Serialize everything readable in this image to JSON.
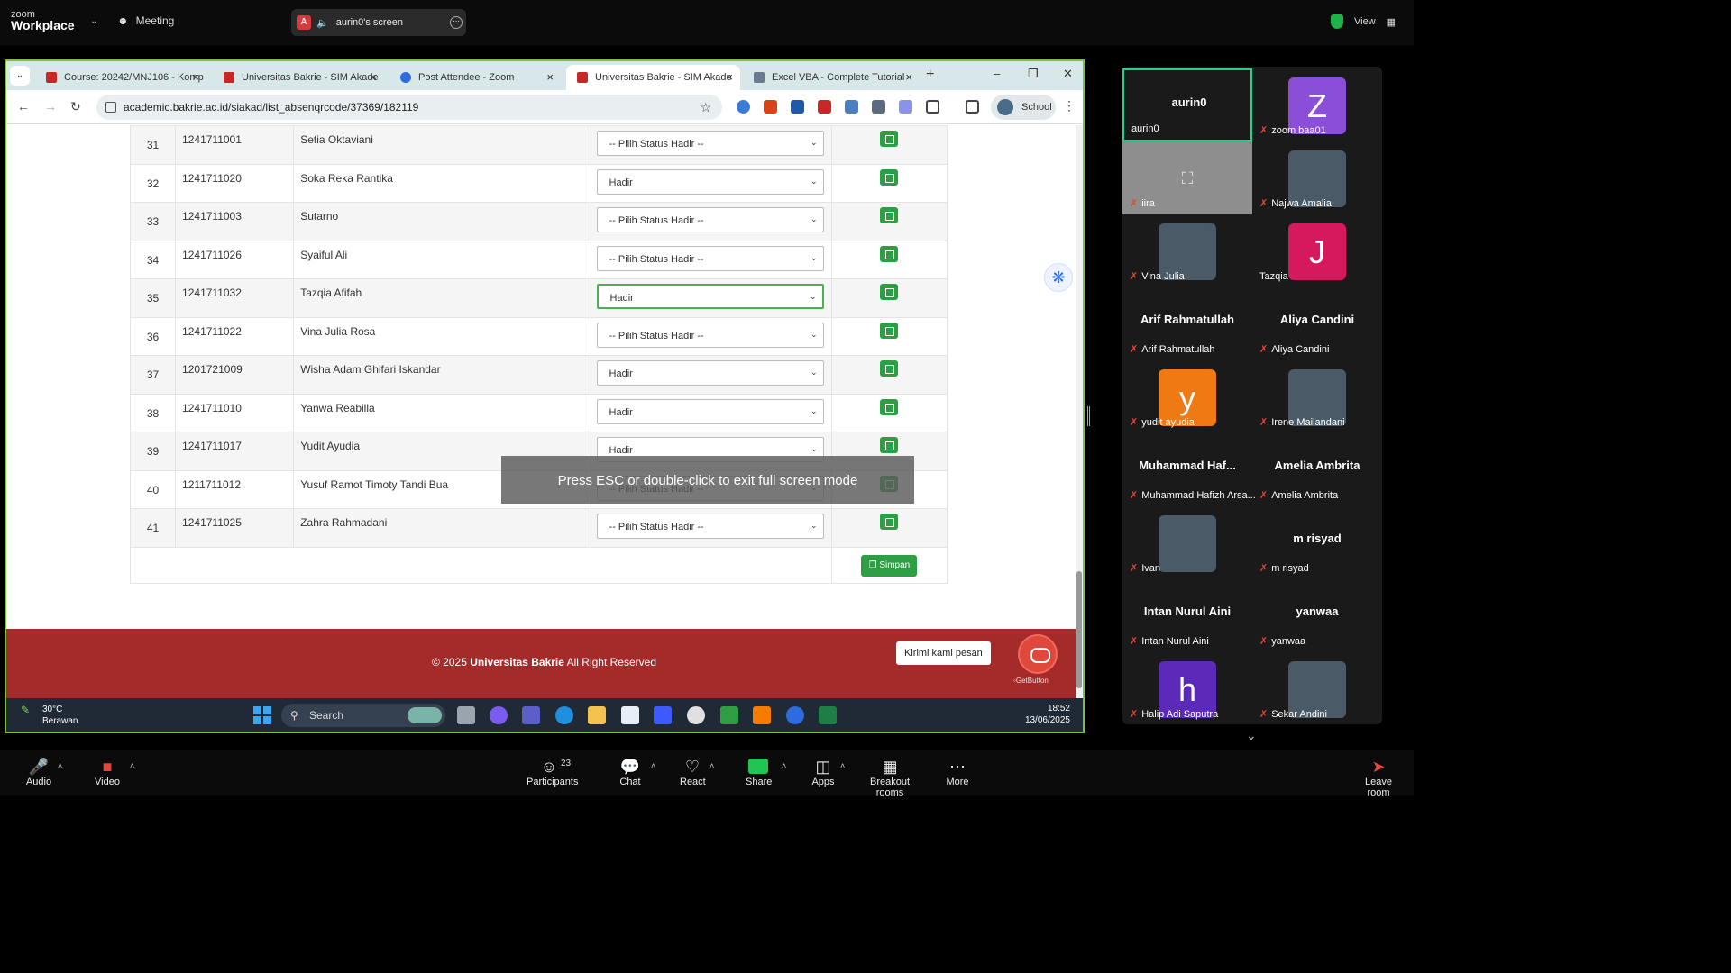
{
  "zoom": {
    "logo_line1": "zoom",
    "logo_line2": "Workplace",
    "meeting_label": "Meeting",
    "screen_share_label": "aurin0's screen",
    "view_label": "View"
  },
  "browser": {
    "tabs": [
      {
        "label": "Course: 20242/MNJ106 - Komp",
        "color": "#c62828"
      },
      {
        "label": "Universitas Bakrie - SIM Akade",
        "color": "#c62828"
      },
      {
        "label": "Post Attendee - Zoom",
        "color": "#2d6be0"
      },
      {
        "label": "Universitas Bakrie - SIM Akade",
        "color": "#c62828"
      },
      {
        "label": "Excel VBA - Complete Tutorial",
        "color": "#6b7a8f"
      }
    ],
    "url": "academic.bakrie.ac.id/siakad/list_absenqrcode/37369/182119",
    "profile_label": "School"
  },
  "attendance": {
    "rows": [
      {
        "no": "31",
        "nim": "1241711001",
        "name": "Setia Oktaviani",
        "status": "-- Pilih Status Hadir --"
      },
      {
        "no": "32",
        "nim": "1241711020",
        "name": "Soka Reka Rantika",
        "status": "Hadir"
      },
      {
        "no": "33",
        "nim": "1241711003",
        "name": "Sutarno",
        "status": "-- Pilih Status Hadir --"
      },
      {
        "no": "34",
        "nim": "1241711026",
        "name": "Syaiful Ali",
        "status": "-- Pilih Status Hadir --"
      },
      {
        "no": "35",
        "nim": "1241711032",
        "name": "Tazqia Afifah",
        "status": "Hadir"
      },
      {
        "no": "36",
        "nim": "1241711022",
        "name": "Vina Julia Rosa",
        "status": "-- Pilih Status Hadir --"
      },
      {
        "no": "37",
        "nim": "1201721009",
        "name": "Wisha Adam Ghifari Iskandar",
        "status": "Hadir"
      },
      {
        "no": "38",
        "nim": "1241711010",
        "name": "Yanwa Reabilla",
        "status": "Hadir"
      },
      {
        "no": "39",
        "nim": "1241711017",
        "name": "Yudit Ayudia",
        "status": "Hadir"
      },
      {
        "no": "40",
        "nim": "1211711012",
        "name": "Yusuf Ramot Timoty Tandi Bua",
        "status": "-- Pilih Status Hadir --"
      },
      {
        "no": "41",
        "nim": "1241711025",
        "name": "Zahra Rahmadani",
        "status": "-- Pilih Status Hadir --"
      }
    ],
    "simpan_label": "Simpan"
  },
  "toast": "Press ESC or double-click to exit full screen mode",
  "footer": {
    "prefix": "© 2025",
    "org": "Universitas Bakrie",
    "suffix": "All Right Reserved",
    "chat_bubble": "Kirimi kami pesan",
    "getbutton": "GetButton"
  },
  "taskbar": {
    "temp": "30°C",
    "weather": "Berawan",
    "search_placeholder": "Search",
    "time": "18:52",
    "date": "13/06/2025"
  },
  "gallery": [
    {
      "big": "aurin0",
      "name": "aurin0",
      "muted": false,
      "active": true
    },
    {
      "initial": "Z",
      "color": "#8a4fd6",
      "name": "zoom baa01",
      "muted": true
    },
    {
      "name": "iira",
      "muted": true,
      "gray": true
    },
    {
      "name": "Najwa Amalia",
      "muted": true
    },
    {
      "name": "Vina Julia",
      "muted": true
    },
    {
      "initial": "J",
      "color": "#d6195d",
      "name": "Tazqia",
      "muted": false
    },
    {
      "big": "Arif Rahmatullah",
      "name": "Arif Rahmatullah",
      "muted": true
    },
    {
      "big": "Aliya Candini",
      "name": "Aliya Candini",
      "muted": true
    },
    {
      "initial": "y",
      "color": "#ef7a14",
      "name": "yudit ayudia",
      "muted": true
    },
    {
      "name": "Irene Mailandani",
      "muted": true
    },
    {
      "big": "Muhammad  Haf...",
      "name": "Muhammad Hafizh Arsa...",
      "muted": true
    },
    {
      "big": "Amelia Ambrita",
      "name": "Amelia Ambrita",
      "muted": true
    },
    {
      "name": "Ivan",
      "muted": true
    },
    {
      "big": "m risyad",
      "name": "m risyad",
      "muted": true
    },
    {
      "big": "Intan Nurul Aini",
      "name": "Intan Nurul Aini",
      "muted": true
    },
    {
      "big": "yanwaa",
      "name": "yanwaa",
      "muted": true
    },
    {
      "initial": "h",
      "color": "#5b2ab8",
      "name": "Halip Adi Saputra",
      "muted": true
    },
    {
      "name": "Sekar Andini",
      "muted": true
    }
  ],
  "toolbar": {
    "audio": "Audio",
    "video": "Video",
    "participants": "Participants",
    "participants_count": "23",
    "chat": "Chat",
    "react": "React",
    "share": "Share",
    "apps": "Apps",
    "breakout": "Breakout rooms",
    "more": "More",
    "leave": "Leave room"
  }
}
